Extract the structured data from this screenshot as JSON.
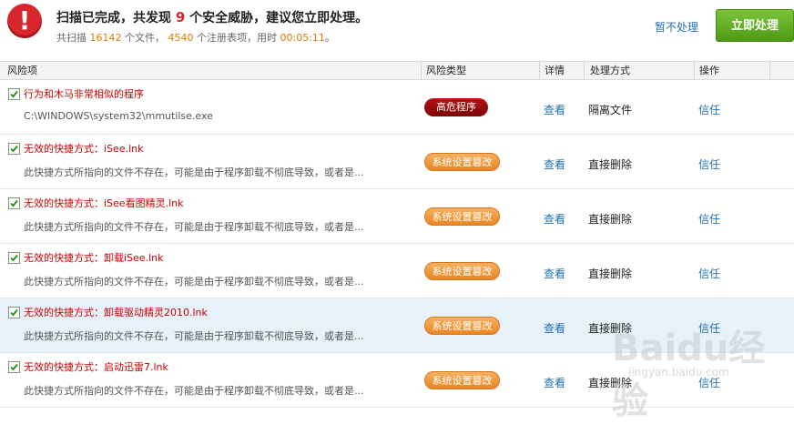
{
  "header": {
    "title_prefix": "扫描已完成，共发现",
    "threat_count": "9",
    "title_suffix": "个安全威胁，建议您立即处理。",
    "sub_scan": "共扫描",
    "files_count": "16142",
    "files_unit": "个文件，",
    "reg_count": "4540",
    "reg_unit": "个注册表项，用时",
    "elapsed": "00:05:11",
    "elapsed_end": "。",
    "skip_label": "暂不处理",
    "fix_label": "立即处理"
  },
  "columns": {
    "risk_item": "风险项",
    "risk_type": "风险类型",
    "detail": "详情",
    "method": "处理方式",
    "action": "操作"
  },
  "rows": [
    {
      "title": "行为和木马非常相似的程序",
      "desc": "C:\\WINDOWS\\system32\\mmutilse.exe",
      "badge": "高危程序",
      "detail": "查看",
      "method": "隔离文件",
      "action": "信任"
    },
    {
      "title": "无效的快捷方式：iSee.lnk",
      "desc": "此快捷方式所指向的文件不存在，可能是由于程序卸载不彻底导致，或者是...",
      "badge": "系统设置篡改",
      "detail": "查看",
      "method": "直接删除",
      "action": "信任"
    },
    {
      "title": "无效的快捷方式：iSee看图精灵.lnk",
      "desc": "此快捷方式所指向的文件不存在，可能是由于程序卸载不彻底导致，或者是...",
      "badge": "系统设置篡改",
      "detail": "查看",
      "method": "直接删除",
      "action": "信任"
    },
    {
      "title": "无效的快捷方式：卸载iSee.lnk",
      "desc": "此快捷方式所指向的文件不存在，可能是由于程序卸载不彻底导致，或者是...",
      "badge": "系统设置篡改",
      "detail": "查看",
      "method": "直接删除",
      "action": "信任"
    },
    {
      "title": "无效的快捷方式：卸载驱动精灵2010.lnk",
      "desc": "此快捷方式所指向的文件不存在，可能是由于程序卸载不彻底导致，或者是...",
      "badge": "系统设置篡改",
      "detail": "查看",
      "method": "直接删除",
      "action": "信任"
    },
    {
      "title": "无效的快捷方式：启动迅雷7.lnk",
      "desc": "此快捷方式所指向的文件不存在，可能是由于程序卸载不彻底导致，或者是...",
      "badge": "系统设置篡改",
      "detail": "查看",
      "method": "直接删除",
      "action": "信任"
    }
  ],
  "watermark": {
    "logo": "Baidu经验",
    "url": "jingyan.baidu.com"
  },
  "colors": {
    "accent_red": "#d8262d",
    "link_blue": "#1f6fb2",
    "button_green": "#5aa61c",
    "highlight_row": "#e6f1fa"
  }
}
